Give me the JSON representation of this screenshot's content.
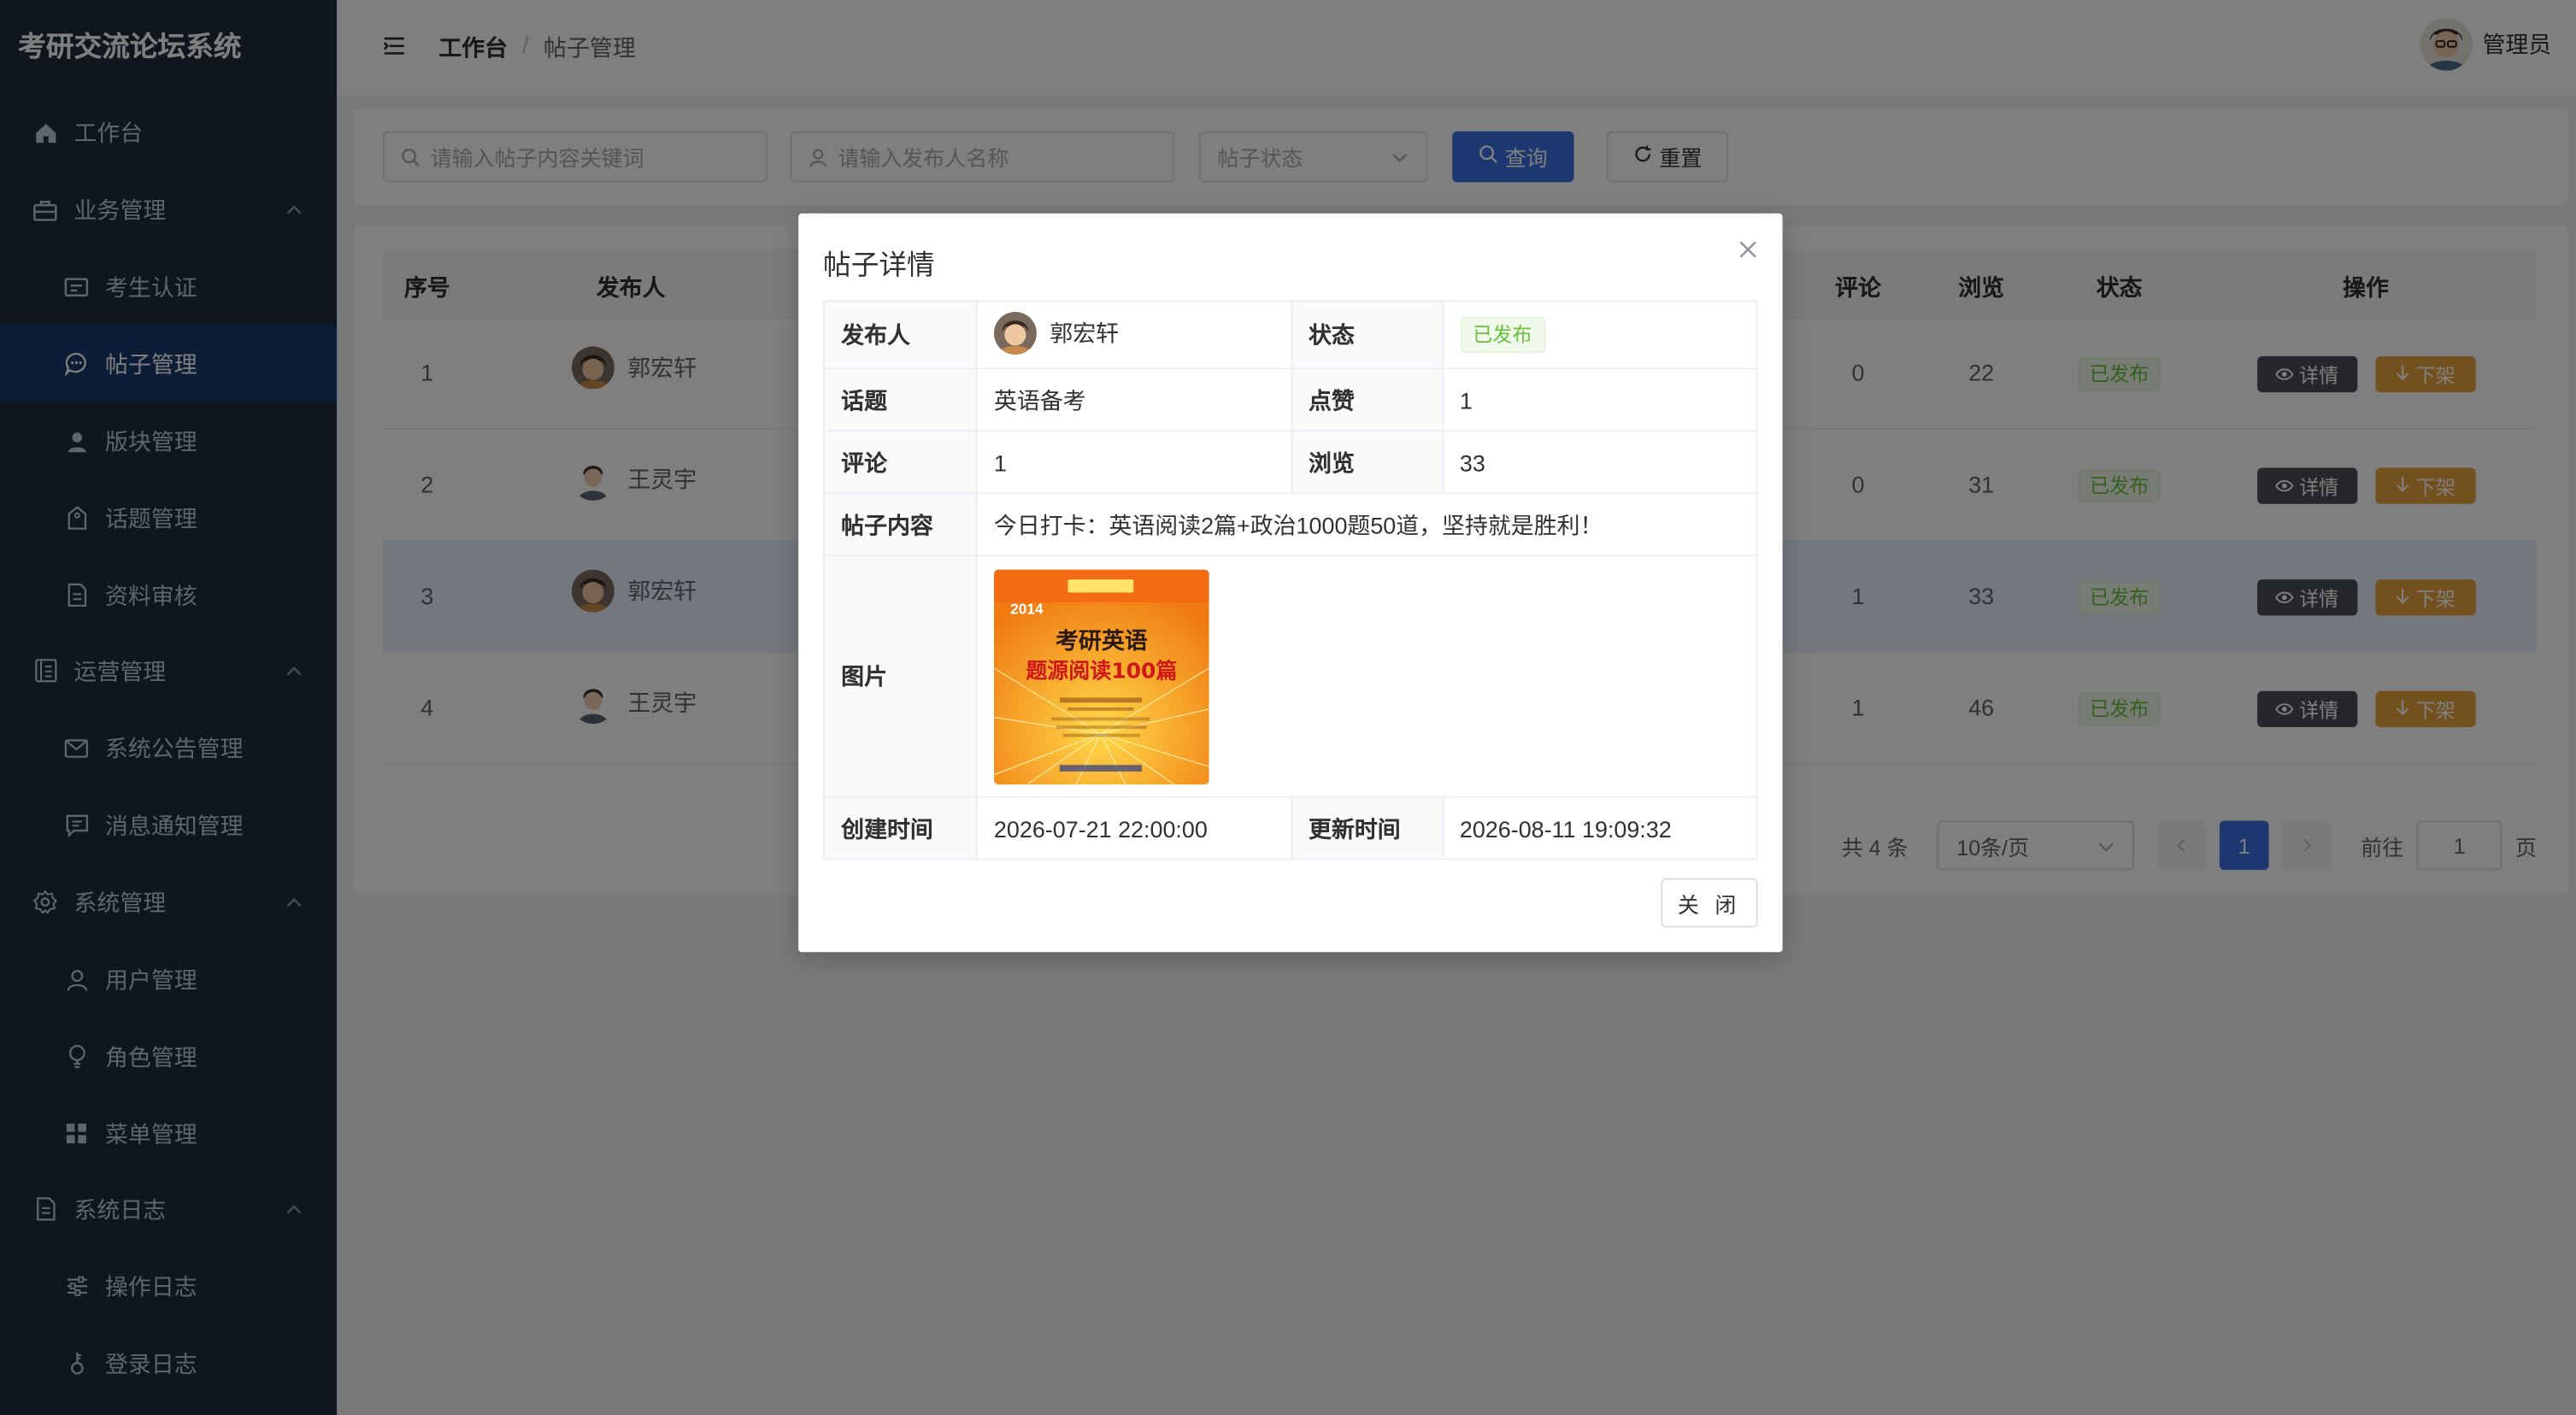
{
  "app": {
    "title": "考研交流论坛系统"
  },
  "sidebar": {
    "items": [
      {
        "label": "工作台",
        "icon": "home-icon"
      },
      {
        "label": "业务管理",
        "icon": "briefcase-icon"
      },
      {
        "label": "考生认证",
        "icon": "id-card-icon"
      },
      {
        "label": "帖子管理",
        "icon": "chat-bubble-icon",
        "active": true
      },
      {
        "label": "版块管理",
        "icon": "person-icon"
      },
      {
        "label": "话题管理",
        "icon": "tag-icon"
      },
      {
        "label": "资料审核",
        "icon": "document-icon"
      },
      {
        "label": "运营管理",
        "icon": "clipboard-icon"
      },
      {
        "label": "系统公告管理",
        "icon": "envelope-icon"
      },
      {
        "label": "消息通知管理",
        "icon": "message-icon"
      },
      {
        "label": "系统管理",
        "icon": "gear-icon"
      },
      {
        "label": "用户管理",
        "icon": "user-icon"
      },
      {
        "label": "角色管理",
        "icon": "lightbulb-icon"
      },
      {
        "label": "菜单管理",
        "icon": "grid-icon"
      },
      {
        "label": "系统日志",
        "icon": "log-icon"
      },
      {
        "label": "操作日志",
        "icon": "sliders-icon"
      },
      {
        "label": "登录日志",
        "icon": "key-icon"
      }
    ]
  },
  "header": {
    "breadcrumb": [
      "工作台",
      "/",
      "帖子管理"
    ],
    "user": "管理员"
  },
  "search": {
    "content_placeholder": "请输入帖子内容关键词",
    "author_placeholder": "请输入发布人名称",
    "status_placeholder": "帖子状态",
    "query_label": "查询",
    "reset_label": "重置"
  },
  "table": {
    "columns": [
      "序号",
      "发布人",
      "评论",
      "浏览",
      "状态",
      "操作"
    ],
    "detail_label": "详情",
    "offline_label": "下架",
    "rows": [
      {
        "no": "1",
        "author": "郭宏轩",
        "comments": "0",
        "views": "22",
        "status": "已发布"
      },
      {
        "no": "2",
        "author": "王灵宇",
        "comments": "0",
        "views": "31",
        "status": "已发布"
      },
      {
        "no": "3",
        "author": "郭宏轩",
        "comments": "1",
        "views": "33",
        "status": "已发布"
      },
      {
        "no": "4",
        "author": "王灵宇",
        "comments": "1",
        "views": "46",
        "status": "已发布"
      }
    ]
  },
  "pagination": {
    "total": "共 4 条",
    "page_size": "10条/页",
    "current_page": "1",
    "goto_prefix": "前往",
    "goto_value": "1",
    "goto_suffix": "页"
  },
  "dialog": {
    "title": "帖子详情",
    "labels": {
      "author": "发布人",
      "status": "状态",
      "topic": "话题",
      "likes": "点赞",
      "comments": "评论",
      "views": "浏览",
      "content": "帖子内容",
      "image": "图片",
      "created": "创建时间",
      "updated": "更新时间"
    },
    "values": {
      "author": "郭宏轩",
      "status": "已发布",
      "topic": "英语备考",
      "likes": "1",
      "comments": "1",
      "views": "33",
      "content": "今日打卡：英语阅读2篇+政治1000题50道，坚持就是胜利！",
      "created": "2026-07-21 22:00:00",
      "updated": "2026-08-11 19:09:32"
    },
    "book_cover": {
      "year": "2014",
      "line1": "考研英语",
      "line2": "题源阅读100篇"
    },
    "close_label": "关 闭"
  }
}
